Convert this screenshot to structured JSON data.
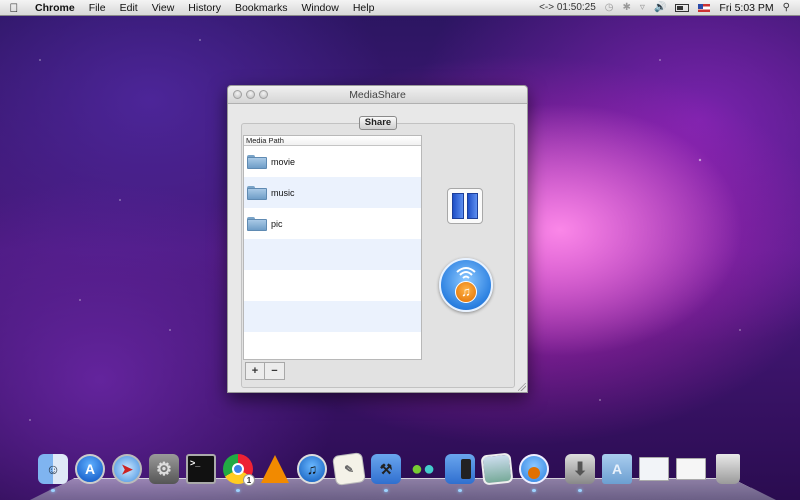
{
  "menubar": {
    "apple_icon": "apple-logo-icon",
    "app_name": "Chrome",
    "menus": [
      "File",
      "Edit",
      "View",
      "History",
      "Bookmarks",
      "Window",
      "Help"
    ],
    "timer": "<-> 01:50:25",
    "clock": "Fri 5:03 PM",
    "status_icons": [
      "time-machine-icon",
      "bluetooth-icon",
      "wifi-icon",
      "volume-icon",
      "battery-icon",
      "input-flag-icon",
      "spotlight-icon"
    ]
  },
  "window": {
    "title": "MediaShare",
    "share_button": "Share",
    "table": {
      "header": "Media Path",
      "rows": [
        {
          "name": "movie"
        },
        {
          "name": "music"
        },
        {
          "name": "pic"
        },
        {
          "name": ""
        },
        {
          "name": ""
        },
        {
          "name": ""
        },
        {
          "name": ""
        }
      ]
    },
    "add_button": "+",
    "remove_button": "−"
  },
  "dock": {
    "items": [
      {
        "name": "Finder",
        "icon": "finder-icon",
        "running": true
      },
      {
        "name": "App Store",
        "icon": "app-store-icon",
        "running": false
      },
      {
        "name": "Safari",
        "icon": "safari-icon",
        "running": false
      },
      {
        "name": "System Preferences",
        "icon": "system-preferences-icon",
        "running": false
      },
      {
        "name": "Terminal",
        "icon": "terminal-icon",
        "running": false
      },
      {
        "name": "Chrome",
        "icon": "chrome-icon",
        "running": true,
        "badge": "1"
      },
      {
        "name": "VLC",
        "icon": "vlc-icon",
        "running": false
      },
      {
        "name": "iTunes",
        "icon": "itunes-icon",
        "running": false
      },
      {
        "name": "TextEdit",
        "icon": "textedit-icon",
        "running": false
      },
      {
        "name": "Xcode",
        "icon": "xcode-icon",
        "running": true
      },
      {
        "name": "Messenger",
        "icon": "messenger-icon",
        "running": false
      },
      {
        "name": "iOS Simulator",
        "icon": "ios-simulator-icon",
        "running": true
      },
      {
        "name": "iPhoto",
        "icon": "iphoto-icon",
        "running": false
      },
      {
        "name": "MediaShare",
        "icon": "mediashare-icon",
        "running": true
      },
      {
        "name": "Downloads Installer",
        "icon": "installer-icon",
        "running": true
      },
      {
        "name": "Applications",
        "icon": "applications-folder-icon",
        "running": false
      },
      {
        "name": "Minimized Window",
        "icon": "minimized-window-icon",
        "running": false
      },
      {
        "name": "Chrome Window",
        "icon": "chrome-window-icon",
        "running": false
      },
      {
        "name": "Trash",
        "icon": "trash-icon",
        "running": false
      }
    ]
  }
}
